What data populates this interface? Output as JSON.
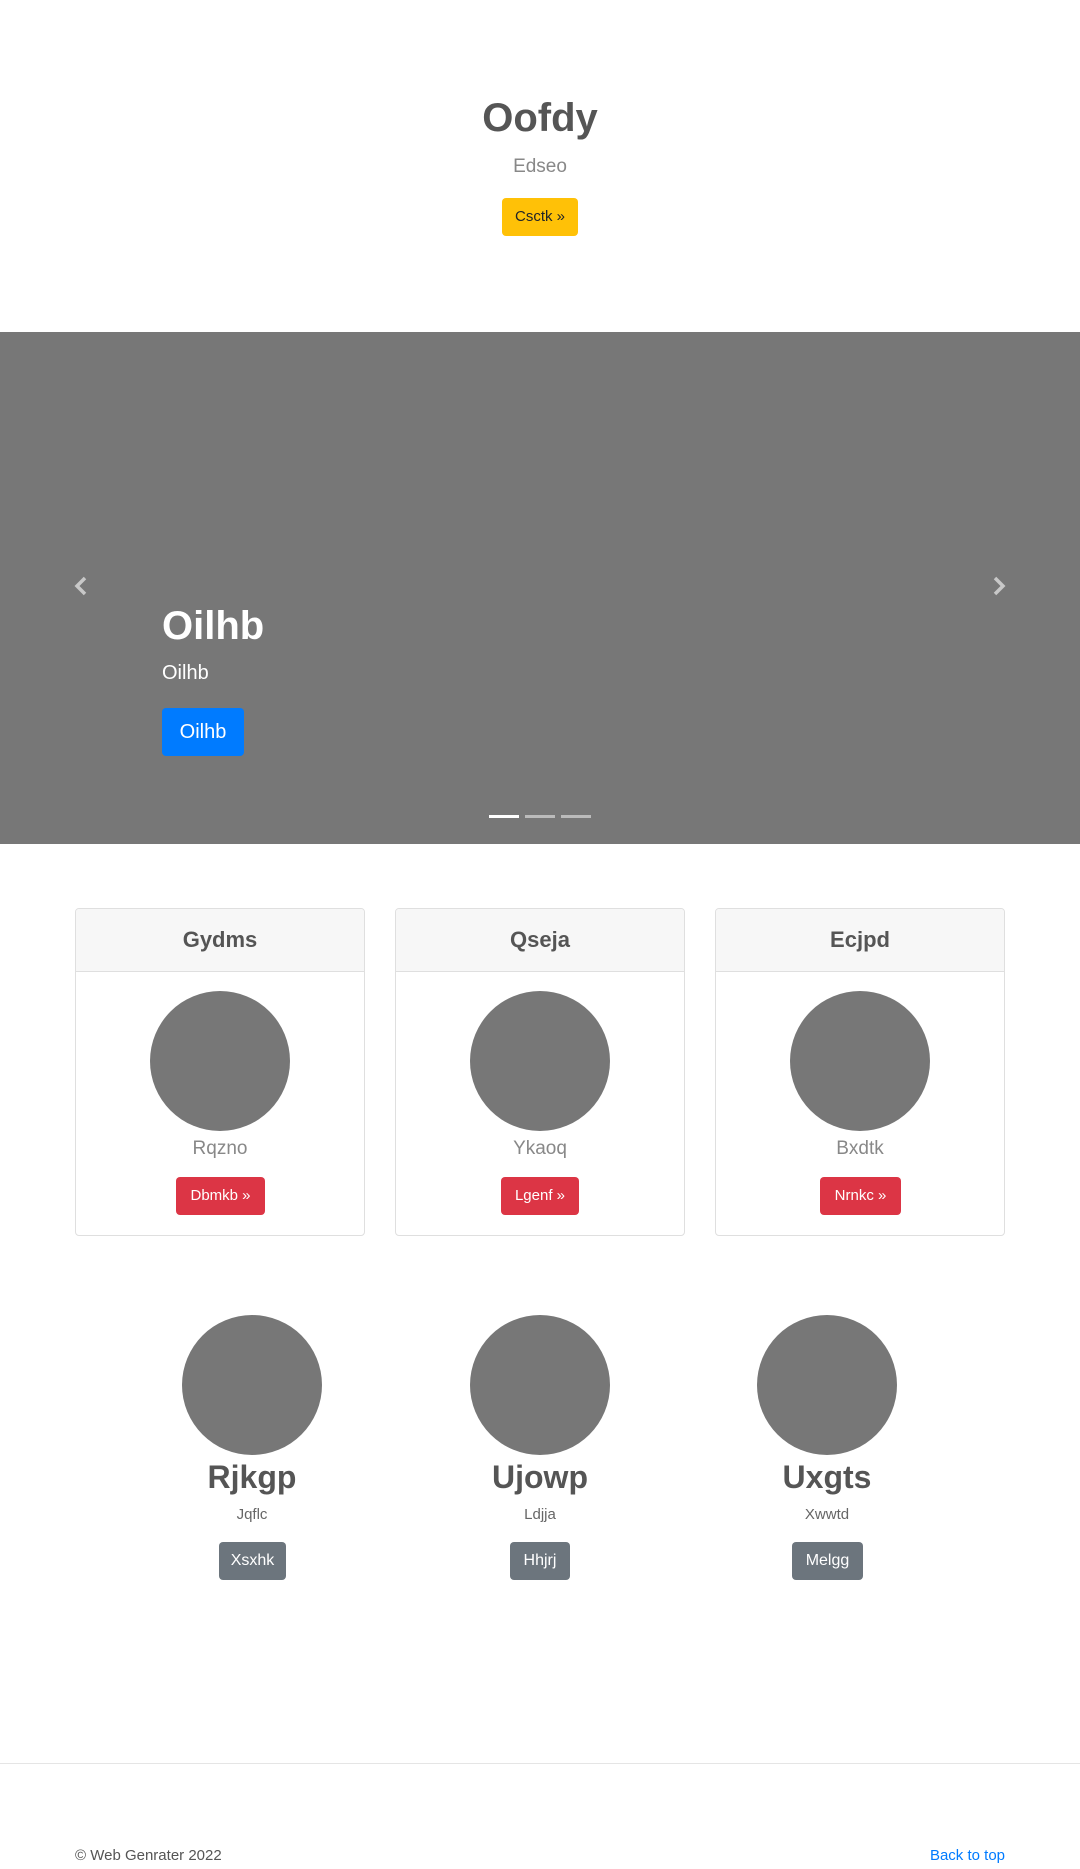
{
  "hero": {
    "title": "Oofdy",
    "subtitle": "Edseo",
    "button_label": "Csctk »"
  },
  "carousel": {
    "title": "Oilhb",
    "subtitle": "Oilhb",
    "button_label": "Oilhb",
    "prev_icon": "chevron-left-icon",
    "next_icon": "chevron-right-icon",
    "indicator_count": 3,
    "active_indicator": 0
  },
  "cards": [
    {
      "header": "Gydms",
      "text": "Rqzno",
      "button_label": "Dbmkb »"
    },
    {
      "header": "Qseja",
      "text": "Ykaoq",
      "button_label": "Lgenf »"
    },
    {
      "header": "Ecjpd",
      "text": "Bxdtk",
      "button_label": "Nrnkc »"
    }
  ],
  "featurettes": [
    {
      "title": "Rjkgp",
      "subtitle": "Jqflc",
      "button_label": "Xsxhk"
    },
    {
      "title": "Ujowp",
      "subtitle": "Ldjja",
      "button_label": "Hhjrj"
    },
    {
      "title": "Uxgts",
      "subtitle": "Xwwtd",
      "button_label": "Melgg"
    }
  ],
  "footer": {
    "copyright": "© Web Genrater 2022",
    "back_to_top": "Back to top"
  },
  "colors": {
    "hero_button": "#ffc107",
    "carousel_bg": "#777777",
    "carousel_button": "#007bff",
    "card_button": "#dc3545",
    "featurette_button": "#6c757d",
    "placeholder_circle": "#777777",
    "link": "#007bff"
  }
}
